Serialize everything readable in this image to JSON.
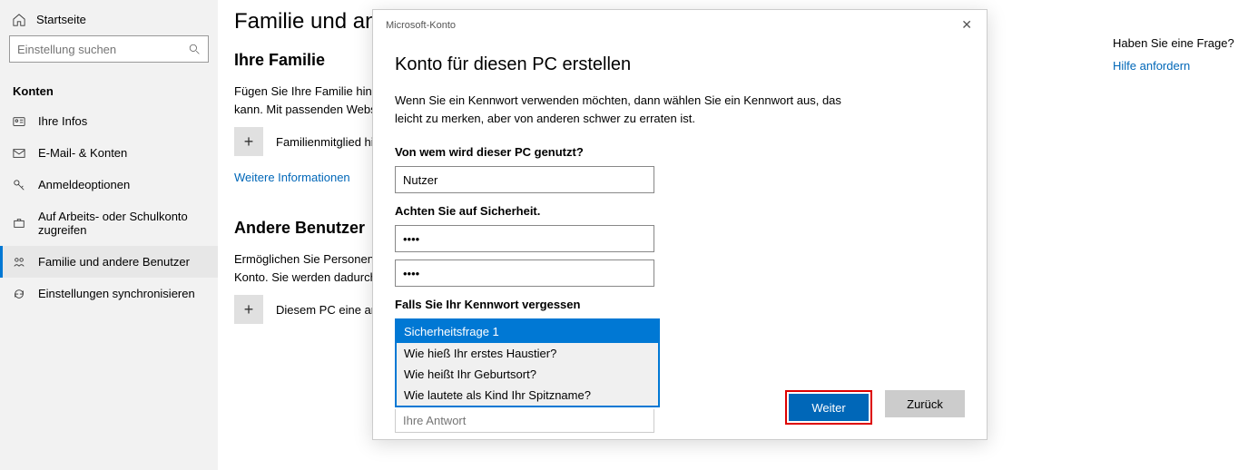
{
  "sidebar": {
    "home": "Startseite",
    "search_placeholder": "Einstellung suchen",
    "section": "Konten",
    "items": [
      {
        "label": "Ihre Infos"
      },
      {
        "label": "E-Mail- & Konten"
      },
      {
        "label": "Anmeldeoptionen"
      },
      {
        "label": "Auf Arbeits- oder Schulkonto zugreifen"
      },
      {
        "label": "Familie und andere Benutzer"
      },
      {
        "label": "Einstellungen synchronisieren"
      }
    ]
  },
  "page": {
    "title": "Familie und andere Benutzer",
    "family_heading": "Ihre Familie",
    "family_text": "Fügen Sie Ihre Familie hinzu, damit jeder seinen eigenen Anmeldenamen und Desktop nutzen kann. Mit passenden Websites, Zeitlimits, Apps und Spiele helfen Sie bei Kindern für Sicherheit.",
    "add_family": "Familienmitglied hinzufügen",
    "more_info": "Weitere Informationen",
    "other_heading": "Andere Benutzer",
    "other_text": "Ermöglichen Sie Personen, die nicht zu Ihrer Familie gehören, die Anmeldung mit ihrem eigenen Konto. Sie werden dadurch nicht automatisch zu Familienmitgliedern.",
    "add_other": "Diesem PC eine andere Person hinzufügen"
  },
  "right": {
    "question": "Haben Sie eine Frage?",
    "help": "Hilfe anfordern"
  },
  "modal": {
    "window_title": "Microsoft-Konto",
    "title": "Konto für diesen PC erstellen",
    "desc": "Wenn Sie ein Kennwort verwenden möchten, dann wählen Sie ein Kennwort aus, das leicht zu merken, aber von anderen schwer zu erraten ist.",
    "who_label": "Von wem wird dieser PC genutzt?",
    "who_value": "Nutzer",
    "security_label": "Achten Sie auf Sicherheit.",
    "password_value": "••••",
    "password2_value": "••••",
    "forgot_label": "Falls Sie Ihr Kennwort vergessen",
    "dropdown": {
      "selected": "Sicherheitsfrage 1",
      "options": [
        "Wie hieß Ihr erstes Haustier?",
        "Wie heißt Ihr Geburtsort?",
        "Wie lautete als Kind Ihr Spitzname?"
      ]
    },
    "answer_placeholder": "Ihre Antwort",
    "next": "Weiter",
    "back": "Zurück"
  }
}
